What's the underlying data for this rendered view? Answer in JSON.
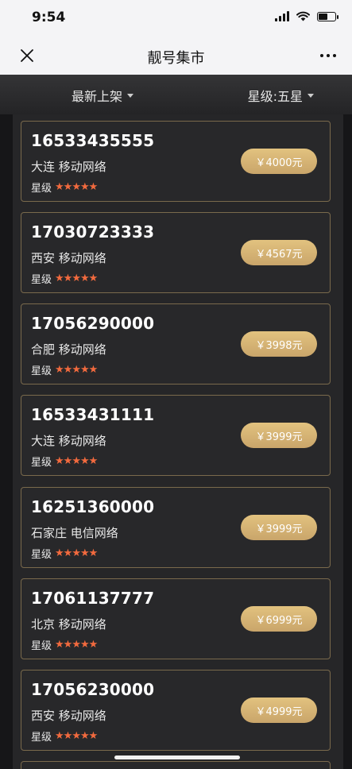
{
  "status_bar": {
    "time": "9:54"
  },
  "nav": {
    "title": "靓号集市"
  },
  "filters": {
    "sort": "最新上架",
    "level": "星级:五星"
  },
  "colors": {
    "star": "#f26a3e",
    "price_gold": "#d2b172",
    "card_border": "#7a6a4c"
  },
  "icons": [
    "close-icon",
    "more-icon",
    "signal-icon",
    "wifi-icon",
    "battery-icon",
    "star-icon",
    "caret-down-icon"
  ],
  "stars_label": "星级",
  "stars_glyph": "★★★★★",
  "listings": [
    {
      "number": "16533435555",
      "location": "大连 移动网络",
      "price": "￥4000元"
    },
    {
      "number": "17030723333",
      "location": "西安 移动网络",
      "price": "￥4567元"
    },
    {
      "number": "17056290000",
      "location": "合肥 移动网络",
      "price": "￥3998元"
    },
    {
      "number": "16533431111",
      "location": "大连 移动网络",
      "price": "￥3999元"
    },
    {
      "number": "16251360000",
      "location": "石家庄 电信网络",
      "price": "￥3999元"
    },
    {
      "number": "17061137777",
      "location": "北京 移动网络",
      "price": "￥6999元"
    },
    {
      "number": "17056230000",
      "location": "西安 移动网络",
      "price": "￥4999元"
    }
  ]
}
